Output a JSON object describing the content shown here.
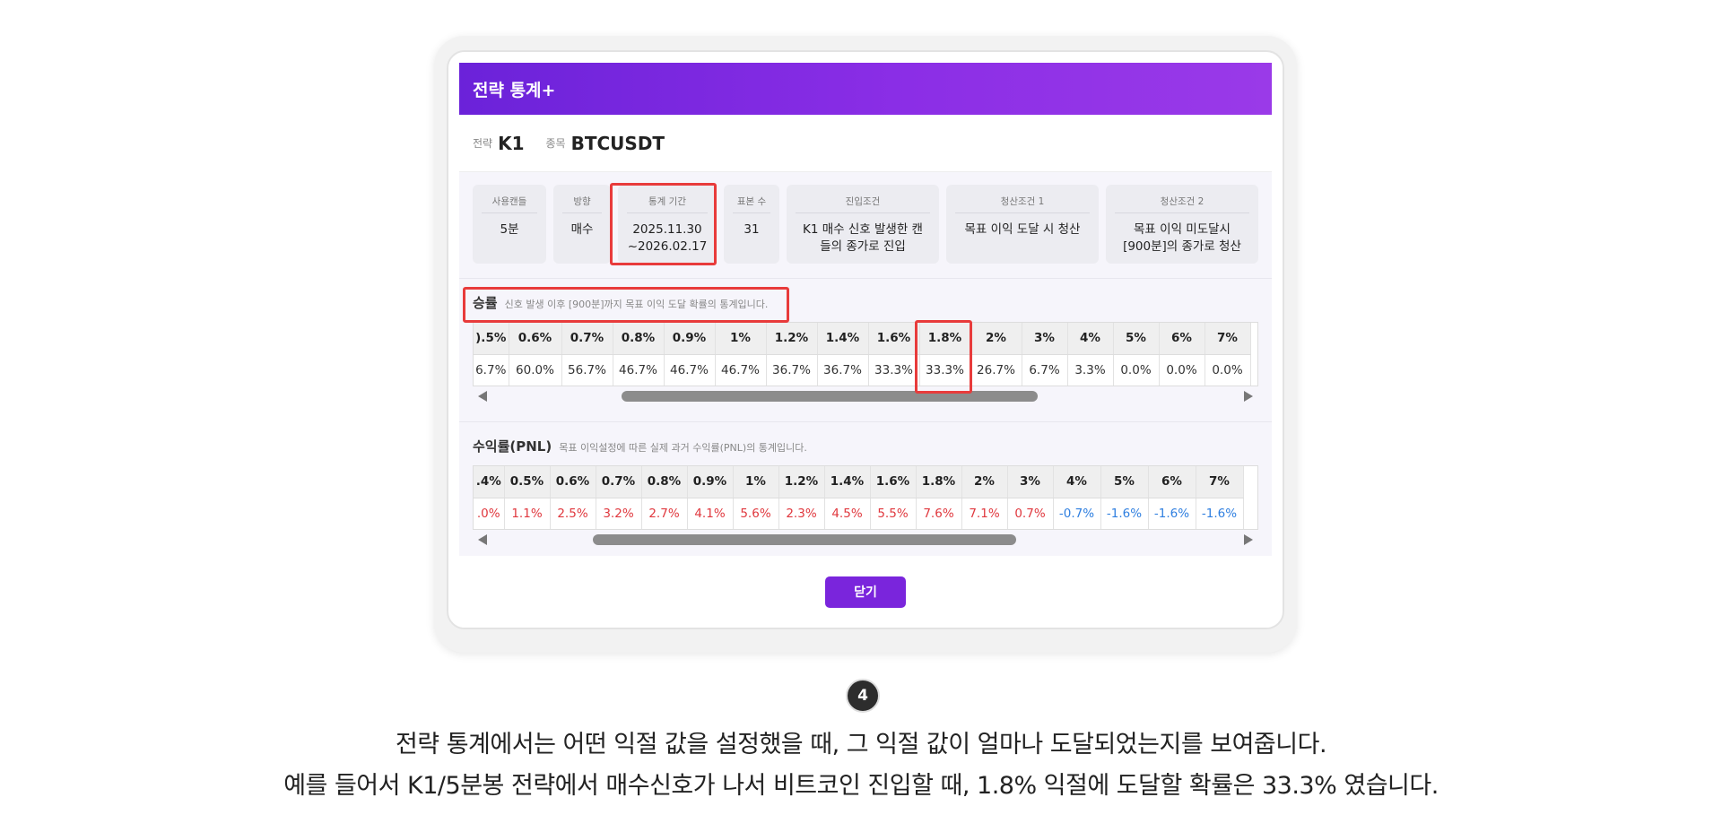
{
  "modal": {
    "title": "전략 통계+",
    "close_label": "닫기"
  },
  "meta": {
    "strategy_key": "전략",
    "strategy_value": "K1",
    "symbol_key": "종목",
    "symbol_value": "BTCUSDT"
  },
  "info_boxes": [
    {
      "label": "사용캔들",
      "value": "5분"
    },
    {
      "label": "방향",
      "value": "매수"
    },
    {
      "label": "통계 기간",
      "value": "2025.11.30\n~2026.02.17"
    },
    {
      "label": "표본 수",
      "value": "31"
    },
    {
      "label": "진입조건",
      "value": "K1 매수 신호 발생한 캔\n들의 종가로 진입"
    },
    {
      "label": "청산조건 1",
      "value": "목표 이익 도달 시 청산"
    },
    {
      "label": "청산조건 2",
      "value": "목표 이익 미도달시\n[900분]의 종가로 청산"
    }
  ],
  "winrate": {
    "title": "승률",
    "desc": "신호 발생 이후 [900분]까지 목표 이익 도달 확률의 통계입니다.",
    "headers": [
      ").5%",
      "0.6%",
      "0.7%",
      "0.8%",
      "0.9%",
      "1%",
      "1.2%",
      "1.4%",
      "1.6%",
      "1.8%",
      "2%",
      "3%",
      "4%",
      "5%",
      "6%",
      "7%"
    ],
    "values": [
      "6.7%",
      "60.0%",
      "56.7%",
      "46.7%",
      "46.7%",
      "46.7%",
      "36.7%",
      "36.7%",
      "33.3%",
      "33.3%",
      "26.7%",
      "6.7%",
      "3.3%",
      "0.0%",
      "0.0%",
      "0.0%"
    ]
  },
  "pnl": {
    "title": "수익률(PNL)",
    "desc": "목표 이익설정에 따른 실제 과거 수익률(PNL)의 통계입니다.",
    "headers": [
      ".4%",
      "0.5%",
      "0.6%",
      "0.7%",
      "0.8%",
      "0.9%",
      "1%",
      "1.2%",
      "1.4%",
      "1.6%",
      "1.8%",
      "2%",
      "3%",
      "4%",
      "5%",
      "6%",
      "7%"
    ],
    "values": [
      ".0%",
      "1.1%",
      "2.5%",
      "3.2%",
      "2.7%",
      "4.1%",
      "5.6%",
      "2.3%",
      "4.5%",
      "5.5%",
      "7.6%",
      "7.1%",
      "0.7%",
      "-0.7%",
      "-1.6%",
      "-1.6%",
      "-1.6%"
    ]
  },
  "step_number": "4",
  "caption": {
    "line1": "전략 통계에서는 어떤 익절 값을 설정했을 때, 그 익절 값이 얼마나 도달되었는지를 보여줍니다.",
    "line2": "예를 들어서 K1/5분봉 전략에서 매수신호가 나서 비트코인 진입할 때, 1.8% 익절에 도달할 확률은 33.3% 였습니다."
  },
  "colors": {
    "header_purple": "#7a25dc",
    "highlight_red": "#e83b3b",
    "positive": "#e0383e",
    "negative": "#2f7fe0"
  },
  "scrollbar_positions": {
    "winrate": 0.5,
    "pnl": 0.45
  }
}
